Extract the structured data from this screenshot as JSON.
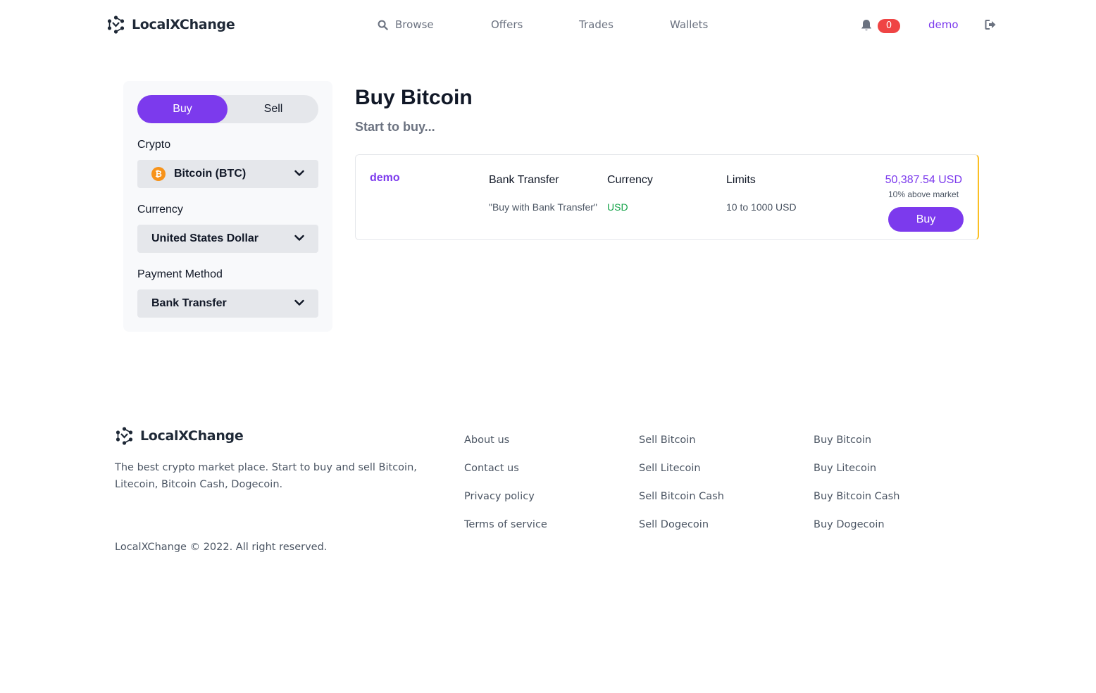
{
  "header": {
    "brand": "LocalXChange",
    "nav": [
      {
        "label": "Browse",
        "icon": "search-icon"
      },
      {
        "label": "Offers"
      },
      {
        "label": "Trades"
      },
      {
        "label": "Wallets"
      }
    ],
    "notification_count": "0",
    "username": "demo"
  },
  "sidebar": {
    "toggle": {
      "buy": "Buy",
      "sell": "Sell",
      "active": "buy"
    },
    "crypto_label": "Crypto",
    "crypto_value": "Bitcoin (BTC)",
    "crypto_symbol": "₿",
    "currency_label": "Currency",
    "currency_value": "United States Dollar",
    "payment_label": "Payment Method",
    "payment_value": "Bank Transfer"
  },
  "main": {
    "title": "Buy Bitcoin",
    "subtitle": "Start to buy...",
    "offers": [
      {
        "user": "demo",
        "method_head": "Bank Transfer",
        "method_val": "\"Buy with Bank Transfer\"",
        "currency_head": "Currency",
        "currency_val": "USD",
        "limits_head": "Limits",
        "limits_val": "10 to 1000 USD",
        "price": "50,387.54 USD",
        "price_note": "10% above market",
        "buy_label": "Buy"
      }
    ]
  },
  "footer": {
    "brand": "LocalXChange",
    "description": "The best crypto market place. Start to buy and sell Bitcoin, Litecoin, Bitcoin Cash, Dogecoin.",
    "col1": [
      "About us",
      "Contact us",
      "Privacy policy",
      "Terms of service"
    ],
    "col2": [
      "Sell Bitcoin",
      "Sell Litecoin",
      "Sell Bitcoin Cash",
      "Sell Dogecoin"
    ],
    "col3": [
      "Buy Bitcoin",
      "Buy Litecoin",
      "Buy Bitcoin Cash",
      "Buy Dogecoin"
    ],
    "copyright": "LocalXChange © 2022. All right reserved."
  },
  "colors": {
    "accent": "#7c3aed",
    "badge": "#ef4444",
    "positive": "#16a34a",
    "card_edge": "#fbbf24"
  }
}
